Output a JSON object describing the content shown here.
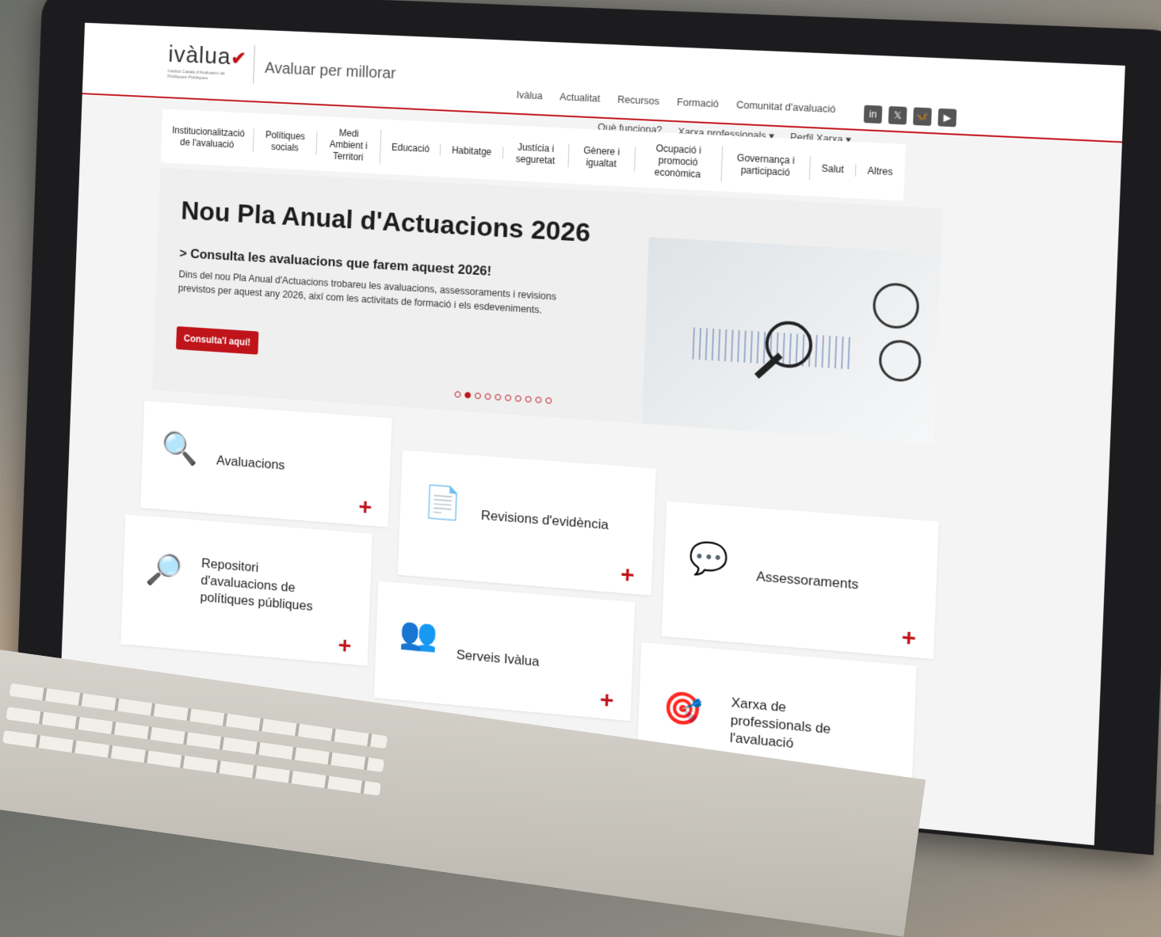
{
  "header": {
    "logo_text": "ivàlua",
    "logo_check": "✔",
    "logo_subtitle": "Institut Català d'Avaluació de Polítiques Públiques",
    "tagline": "Avaluar per millorar",
    "topnav": [
      "Ivàlua",
      "Actualitat",
      "Recursos",
      "Formació",
      "Comunitat d'avaluació"
    ],
    "subnav": [
      "Què funciona?",
      "Xarxa professionals ▾",
      "Perfil Xarxa ▾"
    ],
    "social_icons": [
      "linkedin-icon",
      "x-icon",
      "bluesky-icon",
      "youtube-icon"
    ]
  },
  "categories": [
    "Institucionalització de l'avaluació",
    "Polítiques socials",
    "Medi Ambient i Territori",
    "Educació",
    "Habitatge",
    "Justícia i seguretat",
    "Gènere i igualtat",
    "Ocupació i promoció econòmica",
    "Governança i participació",
    "Salut",
    "Altres"
  ],
  "hero": {
    "title": "Nou Pla Anual d'Actuacions 2026",
    "subtitle": "> Consulta les avaluacions que farem aquest 2026!",
    "text": "Dins del nou Pla Anual d'Actuacions trobareu les avaluacions, assessoraments i revisions previstos per aquest any 2026, així com les activitats de formació i els esdeveniments.",
    "button": "Consulta'l aquí!",
    "slides_total": 10,
    "slide_active": 2
  },
  "cards": [
    {
      "label": "Avaluacions",
      "icon": "evaluation-icon",
      "plus": "+"
    },
    {
      "label": "Revisions d'evidència",
      "icon": "evidence-review-icon",
      "plus": "+"
    },
    {
      "label": "Assessoraments",
      "icon": "advisory-icon",
      "plus": "+"
    },
    {
      "label": "Repositori d'avaluacions de polítiques públiques",
      "icon": "repository-icon",
      "plus": "+"
    },
    {
      "label": "Serveis Ivàlua",
      "icon": "services-icon",
      "plus": "+"
    },
    {
      "label": "Xarxa de professionals de l'avaluació",
      "icon": "network-icon",
      "plus": "+"
    }
  ],
  "colors": {
    "accent": "#c0141b",
    "dark": "#1b2a4a"
  }
}
